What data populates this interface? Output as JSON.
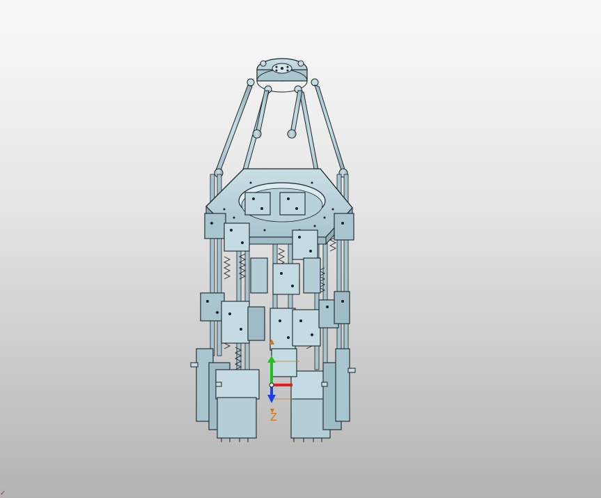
{
  "viewport": {
    "background_top": "#f9f9f9",
    "background_bottom": "#b3b3b3",
    "model_color": "#b9d3dc",
    "model_shadow": "#7f9eaa",
    "edge_color": "#1b2328"
  },
  "triad": {
    "z_label": "Z",
    "x_color": "#e02020",
    "y_color": "#20c020",
    "z_color": "#2040e0",
    "label_color": "#c8791b"
  },
  "corner_mark": "✓"
}
